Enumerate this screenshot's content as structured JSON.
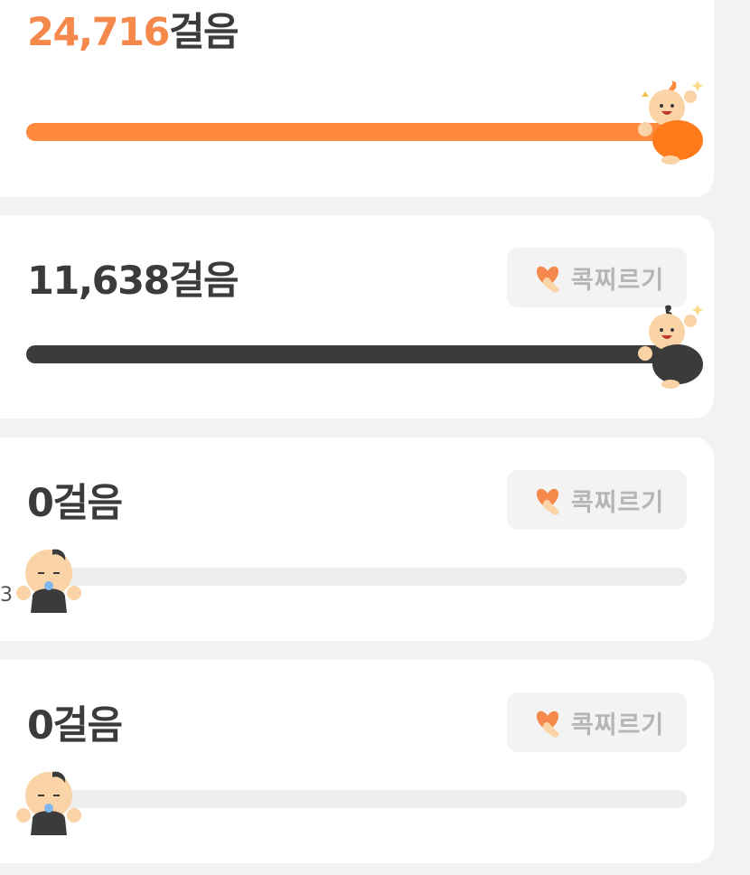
{
  "members": [
    {
      "steps_number": "24,716",
      "steps_unit": "걸음",
      "progress": 1.0,
      "bar_color": "#ff8a3d",
      "mascot": "cheering-orange-mascot-icon",
      "poke_label": ""
    },
    {
      "steps_number": "11,638",
      "steps_unit": "걸음",
      "progress": 1.0,
      "bar_color": "#3b3b3b",
      "mascot": "cheering-black-mascot-icon",
      "poke_label": "콕찌르기"
    },
    {
      "steps_number": "0",
      "steps_unit": "걸음",
      "progress": 0.0,
      "bar_color": "#eeeeee",
      "mascot": "sleeping-baby-mascot-icon",
      "poke_label": "콕찌르기"
    },
    {
      "steps_number": "0",
      "steps_unit": "걸음",
      "progress": 0.0,
      "bar_color": "#eeeeee",
      "mascot": "sleeping-baby-mascot-icon",
      "poke_label": "콕찌르기"
    }
  ],
  "edge_mark": "3",
  "colors": {
    "accent": "#f4894b",
    "text": "#3b3b3b",
    "muted": "#b5b5b5",
    "background": "#f2f2f2"
  }
}
